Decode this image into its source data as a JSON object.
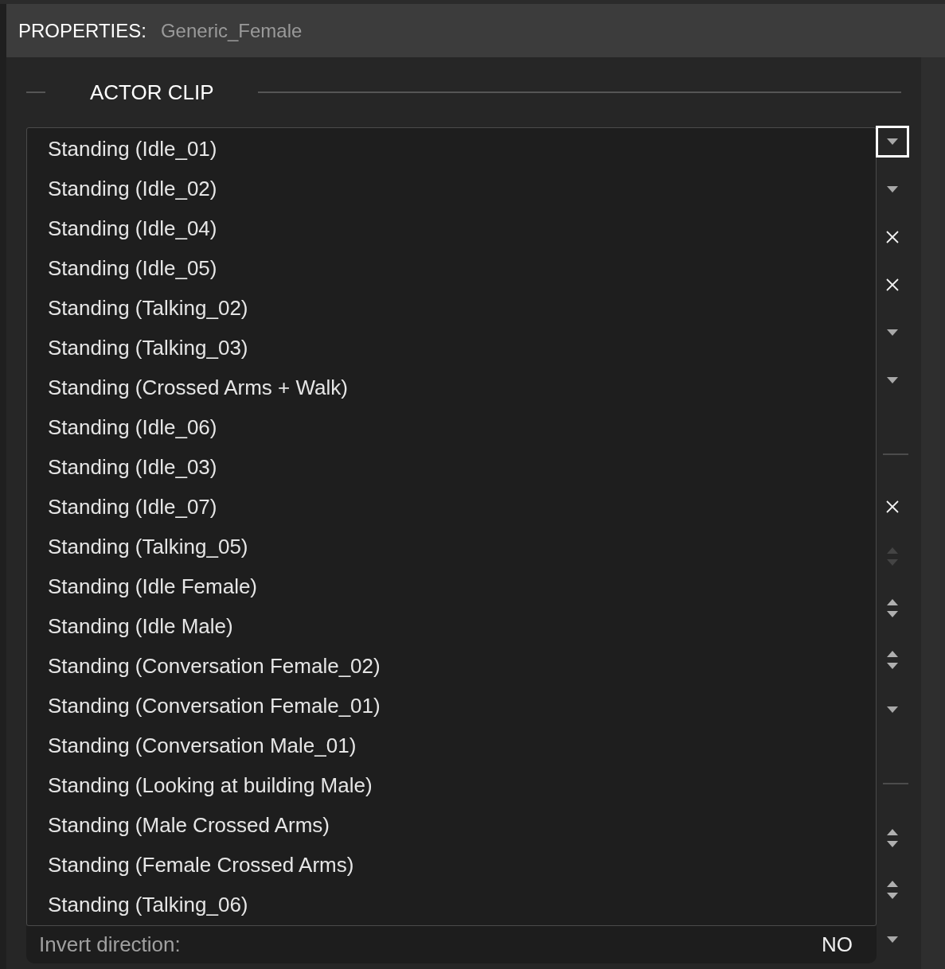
{
  "header": {
    "label": "PROPERTIES:",
    "object_name": "Generic_Female"
  },
  "section": {
    "title": "ACTOR CLIP"
  },
  "clip_dropdown": {
    "expanded": true,
    "options": [
      {
        "label": "Standing (Idle_01)",
        "selected": false
      },
      {
        "label": "Standing (Idle_02)",
        "selected": false
      },
      {
        "label": "Standing (Idle_04)",
        "selected": false
      },
      {
        "label": "Standing (Idle_05)",
        "selected": false
      },
      {
        "label": "Standing (Talking_02)",
        "selected": false
      },
      {
        "label": "Standing (Talking_03)",
        "selected": false
      },
      {
        "label": "Standing (Crossed Arms + Walk)",
        "selected": false
      },
      {
        "label": "Standing (Idle_06)",
        "selected": false
      },
      {
        "label": "Standing (Idle_03)",
        "selected": false
      },
      {
        "label": "Standing (Idle_07)",
        "selected": false
      },
      {
        "label": "Standing (Talking_05)",
        "selected": false
      },
      {
        "label": "Standing (Idle Female)",
        "selected": false
      },
      {
        "label": "Standing (Idle Male)",
        "selected": false
      },
      {
        "label": "Standing (Conversation Female_02)",
        "selected": false
      },
      {
        "label": "Standing (Conversation Female_01)",
        "selected": false
      },
      {
        "label": "Standing (Conversation Male_01)",
        "selected": false
      },
      {
        "label": "Standing (Looking at building Male)",
        "selected": false
      },
      {
        "label": "Standing (Male Crossed Arms)",
        "selected": false
      },
      {
        "label": "Standing (Female Crossed Arms)",
        "selected": false
      },
      {
        "label": "Standing (Talking_06)",
        "selected": false
      }
    ]
  },
  "invert_direction": {
    "label": "Invert direction:",
    "value": "NO"
  },
  "side_controls": [
    {
      "kind": "dropdown",
      "focused": true
    },
    {
      "kind": "dropdown",
      "focused": false
    },
    {
      "kind": "clear",
      "focused": false
    },
    {
      "kind": "clear",
      "focused": false
    },
    {
      "kind": "dropdown",
      "focused": false
    },
    {
      "kind": "dropdown",
      "focused": false
    },
    {
      "kind": "divider"
    },
    {
      "kind": "clear",
      "focused": false
    },
    {
      "kind": "spinner",
      "focused": false,
      "disabled": true
    },
    {
      "kind": "spinner",
      "focused": false,
      "disabled": false
    },
    {
      "kind": "spinner",
      "focused": false,
      "disabled": false
    },
    {
      "kind": "dropdown",
      "focused": false
    },
    {
      "kind": "divider"
    },
    {
      "kind": "spinner",
      "focused": false,
      "disabled": false
    },
    {
      "kind": "spinner",
      "focused": false,
      "disabled": false
    },
    {
      "kind": "dropdown",
      "focused": false
    }
  ]
}
